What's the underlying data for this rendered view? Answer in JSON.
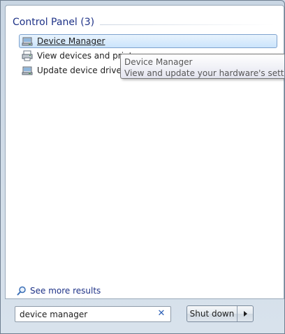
{
  "results": {
    "group_title": "Control Panel (3)",
    "items": [
      {
        "label": "Device Manager",
        "icon": "device-manager-icon",
        "selected": true
      },
      {
        "label": "View devices and printe",
        "icon": "devices-printers-icon",
        "selected": false
      },
      {
        "label": "Update device drivers",
        "icon": "device-drivers-icon",
        "selected": false
      }
    ]
  },
  "tooltip": {
    "title": "Device Manager",
    "description": "View and update your hardware's settings and"
  },
  "see_more": {
    "label": "See more results",
    "icon": "search-icon"
  },
  "search": {
    "value": "device manager",
    "clear_icon": "close-icon"
  },
  "shutdown": {
    "label": "Shut down",
    "icon": "chevron-right-icon"
  },
  "colors": {
    "accent": "#1e3287",
    "selection_border": "#7da2ce",
    "selection_fill": "#cbe4fb"
  }
}
